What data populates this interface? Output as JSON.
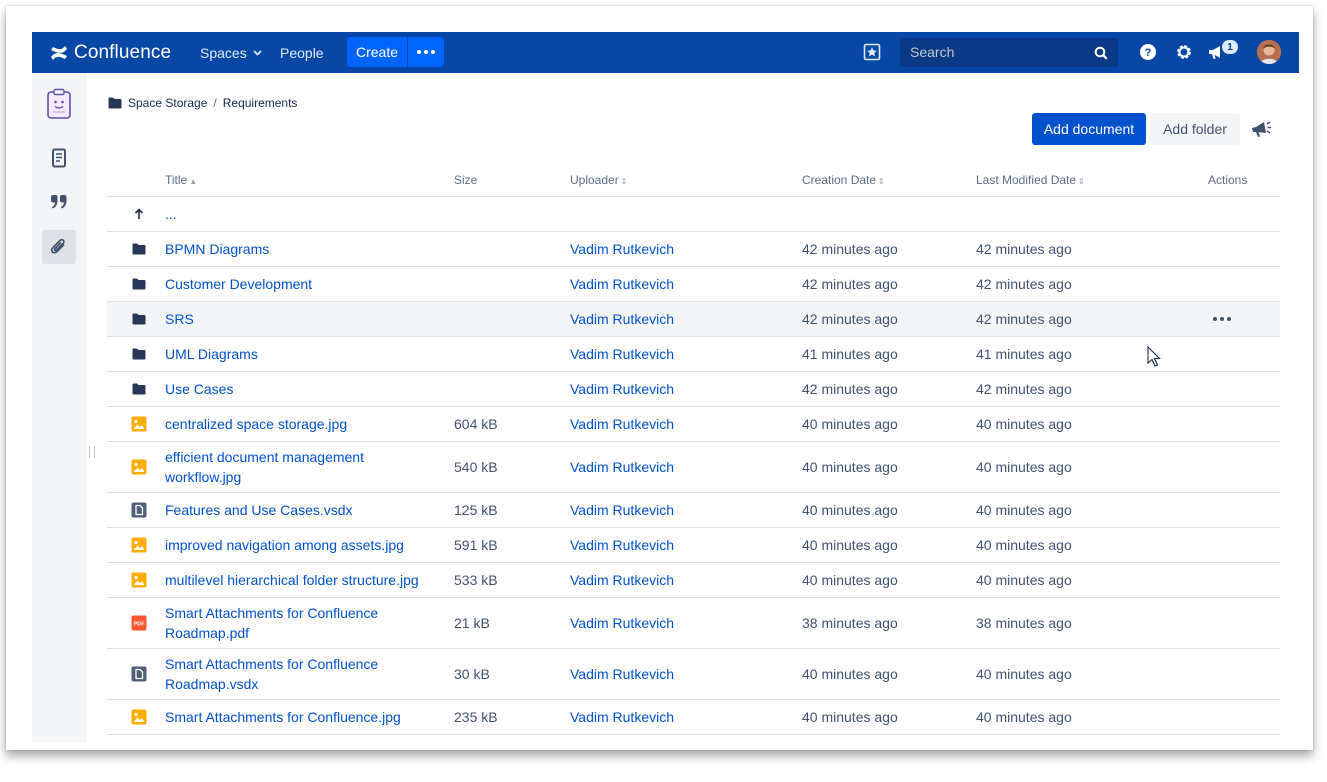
{
  "header": {
    "logo_text": "Confluence",
    "nav": {
      "spaces": "Spaces",
      "people": "People"
    },
    "create_label": "Create",
    "search_placeholder": "Search",
    "notification_count": "1"
  },
  "breadcrumb": {
    "parent": "Space Storage",
    "separator": "/",
    "current": "Requirements"
  },
  "actions": {
    "add_document": "Add document",
    "add_folder": "Add folder"
  },
  "table": {
    "headers": {
      "title": "Title",
      "size": "Size",
      "uploader": "Uploader",
      "creation_date": "Creation Date",
      "last_modified": "Last Modified Date",
      "actions": "Actions"
    },
    "up_row": {
      "label": "..."
    },
    "rows": [
      {
        "type": "folder",
        "icon": "folder-icon",
        "title": "BPMN Diagrams",
        "size": "",
        "uploader": "Vadim Rutkevich",
        "created": "42 minutes ago",
        "modified": "42 minutes ago"
      },
      {
        "type": "folder",
        "icon": "folder-icon",
        "title": "Customer Development",
        "size": "",
        "uploader": "Vadim Rutkevich",
        "created": "42 minutes ago",
        "modified": "42 minutes ago"
      },
      {
        "type": "folder",
        "icon": "folder-icon",
        "title": "SRS",
        "size": "",
        "uploader": "Vadim Rutkevich",
        "created": "42 minutes ago",
        "modified": "42 minutes ago",
        "hover": true
      },
      {
        "type": "folder",
        "icon": "folder-icon",
        "title": "UML Diagrams",
        "size": "",
        "uploader": "Vadim Rutkevich",
        "created": "41 minutes ago",
        "modified": "41 minutes ago"
      },
      {
        "type": "folder",
        "icon": "folder-icon",
        "title": "Use Cases",
        "size": "",
        "uploader": "Vadim Rutkevich",
        "created": "42 minutes ago",
        "modified": "42 minutes ago"
      },
      {
        "type": "image",
        "icon": "image-file-icon",
        "title": "centralized space storage.jpg",
        "size": "604 kB",
        "uploader": "Vadim Rutkevich",
        "created": "40 minutes ago",
        "modified": "40 minutes ago"
      },
      {
        "type": "image",
        "icon": "image-file-icon",
        "title": "efficient document management workflow.jpg",
        "size": "540 kB",
        "uploader": "Vadim Rutkevich",
        "created": "40 minutes ago",
        "modified": "40 minutes ago",
        "tall": true
      },
      {
        "type": "doc",
        "icon": "document-file-icon",
        "title": "Features and Use Cases.vsdx",
        "size": "125 kB",
        "uploader": "Vadim Rutkevich",
        "created": "40 minutes ago",
        "modified": "40 minutes ago"
      },
      {
        "type": "image",
        "icon": "image-file-icon",
        "title": "improved navigation among assets.jpg",
        "size": "591 kB",
        "uploader": "Vadim Rutkevich",
        "created": "40 minutes ago",
        "modified": "40 minutes ago"
      },
      {
        "type": "image",
        "icon": "image-file-icon",
        "title": "multilevel hierarchical folder structure.jpg",
        "size": "533 kB",
        "uploader": "Vadim Rutkevich",
        "created": "40 minutes ago",
        "modified": "40 minutes ago"
      },
      {
        "type": "pdf",
        "icon": "pdf-file-icon",
        "title": "Smart Attachments for Confluence Roadmap.pdf",
        "size": "21 kB",
        "uploader": "Vadim Rutkevich",
        "created": "38 minutes ago",
        "modified": "38 minutes ago",
        "tall": true
      },
      {
        "type": "doc",
        "icon": "document-file-icon",
        "title": "Smart Attachments for Confluence Roadmap.vsdx",
        "size": "30 kB",
        "uploader": "Vadim Rutkevich",
        "created": "40 minutes ago",
        "modified": "40 minutes ago",
        "tall": true
      },
      {
        "type": "image",
        "icon": "image-file-icon",
        "title": "Smart Attachments for Confluence.jpg",
        "size": "235 kB",
        "uploader": "Vadim Rutkevich",
        "created": "40 minutes ago",
        "modified": "40 minutes ago"
      }
    ]
  },
  "colors": {
    "header_bg": "#0747a6",
    "primary": "#0052cc",
    "folder": "#253858",
    "image_icon": "#ffab00",
    "doc_icon": "#505f79",
    "pdf_icon": "#ff5630"
  }
}
